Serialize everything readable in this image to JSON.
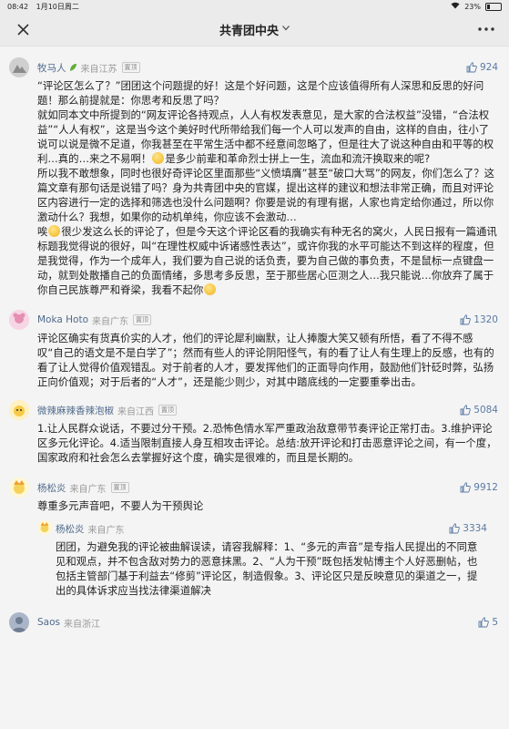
{
  "status": {
    "time": "08:42",
    "date": "1月10日周二",
    "battery": "23%"
  },
  "nav": {
    "title": "共青团中央"
  },
  "comments": [
    {
      "name": "牧马人",
      "from": "来自江苏",
      "pin": "置顶",
      "likes": "924",
      "p1": "“评论区怎么了？”团团这个问题提的好！这是个好问题，这是个应该值得所有人深思和反思的好问题！那么前提就是：你思考和反思了吗？",
      "p2a": "就如同本文中所提到的“网友评论各持观点，人人有权发表意见，是大家的合法权益”没错，“合法权益”“人人有权”，这是当今这个美好时代所带给我们每一个人可以发声的自由，这样的自由，往小了说可以说是微不足道，你我甚至在平常生活中都不经意间忽略了，但是往大了说这种自由和平等的权利…真的…来之不易啊！",
      "p2b": "是多少前辈和革命烈士拼上一生，流血和流汗换取来的呢?",
      "p3": "所以我不敢想象，同时也很好奇评论区里面那些“义愤填膺”甚至“破口大骂”的网友，你们怎么了？这篇文章有那句话是说错了吗？身为共青团中央的官媒，提出这样的建议和想法非常正确，而且对评论区内容进行一定的选择和筛选也没什么问题啊？你要是说的有理有据，人家也肯定给你通过，所以你激动什么？我想，如果你的动机单纯，你应该不会激动…",
      "p4a": "唉",
      "p4b": "很少发这么长的评论了，但是今天这个评论区看的我确实有种无名的窝火，人民日报有一篇通讯标题我觉得说的很好，叫“在理性权威中诉诸感性表达”，或许你我的水平可能达不到这样的程度，但是我觉得，作为一个成年人，我们要为自己说的话负责，要为自己做的事负责，不是鼠标一点键盘一动，就到处散播自己的负面情绪，多思考多反思，至于那些居心叵测之人…我只能说…你放弃了属于你自己民族尊严和脊梁，我看不起你"
    },
    {
      "name": "Moka Hoto",
      "from": "来自广东",
      "pin": "置顶",
      "likes": "1320",
      "text": "评论区确实有货真价实的人才，他们的评论犀利幽默，让人捧腹大笑又顿有所悟，看了不得不感叹“自己的语文是不是白学了”；然而有些人的评论阴阳怪气，有的看了让人有生理上的反感，也有的看了让人觉得价值观错乱。对于前者的人才，要发挥他们的正面导向作用，鼓励他们针砭时弊，弘扬正向价值观；对于后者的“人才”，还是能少则少，对其中踏底线的一定要重拳出击。"
    },
    {
      "name": "微辣麻辣香辣泡椒",
      "from": "来自江西",
      "pin": "置顶",
      "likes": "5084",
      "text": "1.让人民群众说话，不要过分干预。2.恐怖色情水军严重政治敌意带节奏评论正常打击。3.维护评论区多元化评论。4.适当限制直接人身互相攻击评论。总结:放开评论和打击恶意评论之间，有一个度，国家政府和社会怎么去掌握好这个度，确实是很难的，而且是长期的。"
    },
    {
      "name": "杨松炎",
      "from": "来自广东",
      "pin": "置顶",
      "likes": "9912",
      "text": "尊重多元声音吧，不要人为干预舆论",
      "reply": {
        "name": "杨松炎",
        "from": "来自广东",
        "likes": "3334",
        "text": "团团，为避免我的评论被曲解误读，请容我解释：1、“多元的声音”是专指人民提出的不同意见和观点，并不包含敌对势力的恶意抹黑。2、“人为干预”既包括发帖博主个人好恶删帖，也包括主管部门基于利益去“修剪”评论区，制造假象。3、评论区只是反映意见的渠道之一，提出的具体诉求应当找法律渠道解决"
      }
    },
    {
      "name": "Saos",
      "from": "来自浙江",
      "likes": "5"
    }
  ]
}
